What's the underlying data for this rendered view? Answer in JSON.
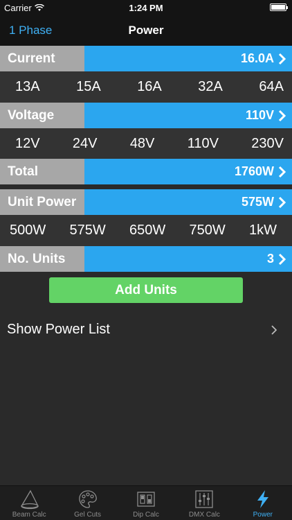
{
  "status": {
    "carrier": "Carrier",
    "time": "1:24 PM"
  },
  "nav": {
    "left": "1 Phase",
    "title": "Power"
  },
  "current": {
    "label": "Current",
    "value": "16.0A",
    "options": [
      "13A",
      "15A",
      "16A",
      "32A",
      "64A"
    ]
  },
  "voltage": {
    "label": "Voltage",
    "value": "110V",
    "options": [
      "12V",
      "24V",
      "48V",
      "110V",
      "230V"
    ]
  },
  "total": {
    "label": "Total",
    "value": "1760W"
  },
  "unit_power": {
    "label": "Unit Power",
    "value": "575W",
    "options": [
      "500W",
      "575W",
      "650W",
      "750W",
      "1kW"
    ]
  },
  "units": {
    "label": "No. Units",
    "value": "3"
  },
  "add_button": "Add Units",
  "show_list": "Show Power List",
  "tabs": [
    {
      "label": "Beam Calc",
      "icon": "beam-icon"
    },
    {
      "label": "Gel Cuts",
      "icon": "palette-icon"
    },
    {
      "label": "Dip Calc",
      "icon": "dip-switch-icon"
    },
    {
      "label": "DMX Calc",
      "icon": "sliders-icon"
    },
    {
      "label": "Power",
      "icon": "lightning-icon"
    }
  ],
  "colors": {
    "accent": "#2ba6ef",
    "label_gray": "#a7a7a7",
    "button_green": "#63d366",
    "active_tab": "#3fb0f4"
  }
}
